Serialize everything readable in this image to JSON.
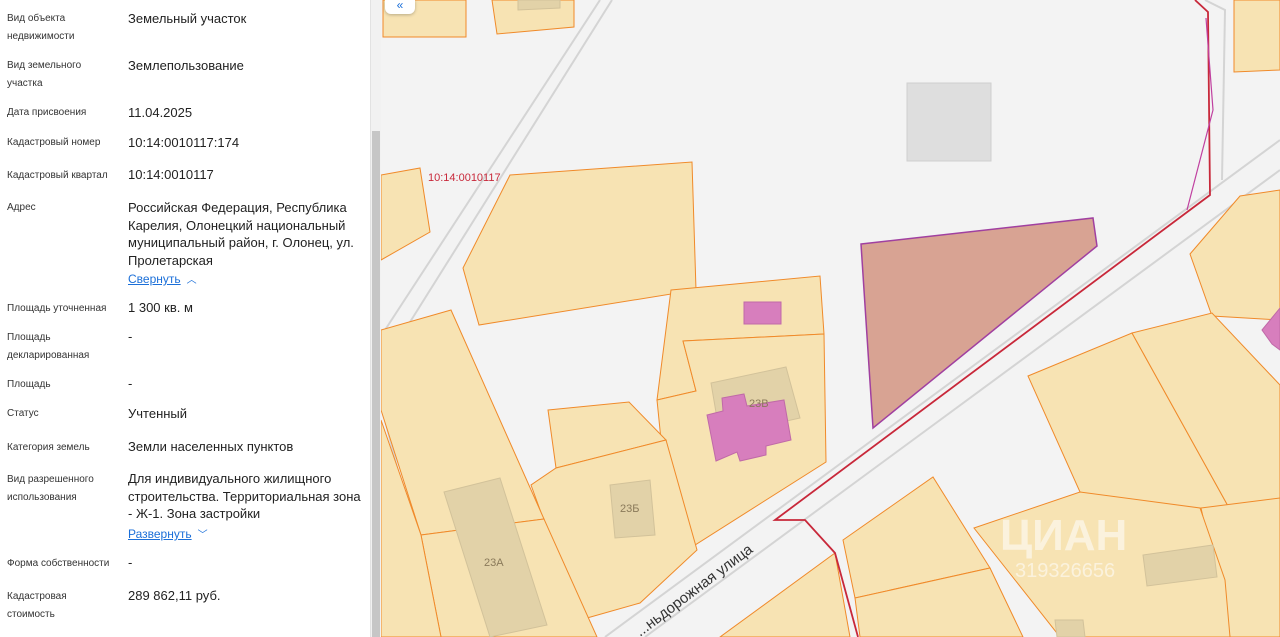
{
  "properties": [
    {
      "label": "Вид объекта недвижимости",
      "value": "Земельный участок"
    },
    {
      "label": "Вид земельного участка",
      "value": "Землепользование"
    },
    {
      "label": "Дата присвоения",
      "value": "11.04.2025"
    },
    {
      "label": "Кадастровый номер",
      "value": "10:14:0010117:174"
    },
    {
      "label": "Кадастровый квартал",
      "value": "10:14:0010117"
    },
    {
      "label": "Адрес",
      "value": "Российская Федерация, Республика Карелия, Олонецкий национальный муниципальный район, г. Олонец, ул. Пролетарская"
    },
    {
      "label": "Площадь уточненная",
      "value": "1 300 кв. м"
    },
    {
      "label": "Площадь декларированная",
      "value": "-"
    },
    {
      "label": "Площадь",
      "value": "-"
    },
    {
      "label": "Статус",
      "value": "Учтенный"
    },
    {
      "label": "Категория земель",
      "value": "Земли населенных пунктов"
    },
    {
      "label": "Вид разрешенного использования",
      "value": "Для индивидуального жилищного строительства. Территориальная зона - Ж-1. Зона застройки"
    },
    {
      "label": "Форма собственности",
      "value": "-"
    },
    {
      "label": "Кадастровая стоимость",
      "value": "289 862,11 руб."
    }
  ],
  "links": {
    "collapse": "Свернуть",
    "expand": "Развернуть"
  },
  "map": {
    "quarter_label": "10:14:0010117",
    "house_labels": [
      "23В",
      "23Б",
      "23А"
    ],
    "street_label": "...ньдорожная улица",
    "watermark": "ЦИАН",
    "watermark_id": "319326656"
  },
  "colors": {
    "parcel_fill": "#f7e3b3",
    "parcel_stroke": "#f08a2a",
    "selected_fill": "#d8a393",
    "selected_stroke": "#a040a0",
    "building": "#d77ebd",
    "boundary": "#c8283a",
    "link": "#1b6fd8"
  },
  "icons": {
    "collapse_panel": "double-chevron-left-icon",
    "collapse_link": "chevron-up-icon",
    "expand_link": "chevron-down-icon"
  }
}
